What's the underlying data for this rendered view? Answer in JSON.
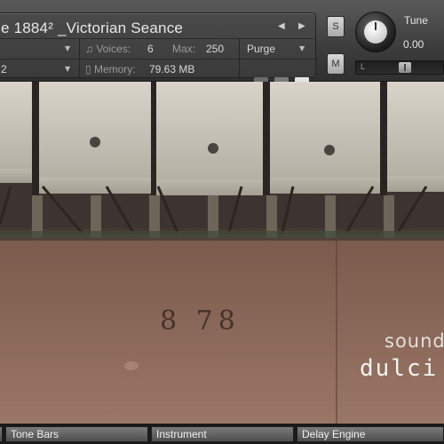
{
  "header": {
    "title": "e 1884² _Victorian Seance",
    "prev_arrow": "◀",
    "next_arrow": "▶",
    "output_row_caret": "▼",
    "midi_value": "2",
    "voices_label": "Voices:",
    "voices_value": "6",
    "max_label": "Max:",
    "max_value": "250",
    "purge_label": "Purge",
    "memory_label": "Memory:",
    "memory_value": "79.63 MB"
  },
  "side_buttons": {
    "solo": "S",
    "mute": "M"
  },
  "tune": {
    "label": "Tune",
    "value": "0.00"
  },
  "pan": {
    "left_label": "L"
  },
  "scene": {
    "serial_number": "8 78",
    "brand_line1": "sound",
    "brand_line2": "dulci"
  },
  "tabs": [
    {
      "label": "Tone Bars"
    },
    {
      "label": "Instrument"
    },
    {
      "label": "Delay Engine"
    }
  ],
  "colors": {
    "header_bg": "#3c3c3c",
    "wood": "#8a6a5a",
    "hammer_felt": "#c9c5bb",
    "tab_bg": "#5e5e5e"
  }
}
